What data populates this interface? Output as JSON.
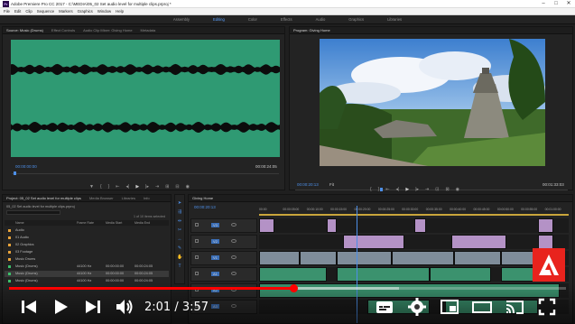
{
  "window": {
    "title": "Adobe Premiere Pro CC 2017 - C:\\MEDIA\\05_02 Set audio level for multiple clips.prproj *",
    "app_icon": "Pr"
  },
  "menu": [
    "File",
    "Edit",
    "Clip",
    "Sequence",
    "Markers",
    "Graphics",
    "Window",
    "Help"
  ],
  "workspaces": {
    "items": [
      "Assembly",
      "Editing",
      "Color",
      "Effects",
      "Audio",
      "Graphics",
      "Libraries"
    ],
    "active": "Editing"
  },
  "source_panel": {
    "tabs": [
      "Source: Music (Drums)",
      "Effect Controls",
      "Audio Clip Mixer: Giving Home",
      "Metadata"
    ],
    "timecode_left": "00:00:00:00",
    "timecode_right": "00:00:24:05",
    "waveform_color": "#2f9a73"
  },
  "program_panel": {
    "tab": "Program: Giving Home",
    "timecode_left": "00:00:20:13",
    "zoom": "Fit",
    "timecode_right": "00:01:33:03"
  },
  "project_panel": {
    "tabs": [
      "Project: 05_02 Set audio level for multiple clips",
      "Media Browser",
      "Libraries",
      "Info"
    ],
    "path": "05_02 Set audio level for multiple clips.prproj",
    "selected_count": "1 of 10 items selected",
    "columns": [
      "Name",
      "Frame Rate",
      "Media Start",
      "Media End"
    ],
    "rows": [
      {
        "name": "Audio",
        "color": "#e8a33a",
        "rate": "",
        "start": "",
        "end": ""
      },
      {
        "name": "01 Audio",
        "color": "#e8a33a",
        "rate": "",
        "start": "",
        "end": ""
      },
      {
        "name": "02 Graphics",
        "color": "#e8a33a",
        "rate": "",
        "start": "",
        "end": ""
      },
      {
        "name": "03 Footage",
        "color": "#e8a33a",
        "rate": "",
        "start": "",
        "end": ""
      },
      {
        "name": "Music Drums",
        "color": "#e8a33a",
        "rate": "",
        "start": "",
        "end": ""
      },
      {
        "name": "Music (Drums)",
        "color": "#3cbf6a",
        "rate": "44100 Hz",
        "start": "00:00:00:00",
        "end": "00:00:24:05"
      },
      {
        "name": "Music (Drums)",
        "color": "#3cbf6a",
        "rate": "44100 Hz",
        "start": "00:00:00:00",
        "end": "00:00:24:05"
      },
      {
        "name": "Music (Drums)",
        "color": "#3cbf6a",
        "rate": "44100 Hz",
        "start": "00:00:00:00",
        "end": "00:00:24:05"
      }
    ]
  },
  "timeline_panel": {
    "tab": "Giving Home",
    "timecode": "00:00:20:13",
    "ruler": [
      "00:00",
      "00:00:05:00",
      "00:00:10:00",
      "00:00:15:00",
      "00:00:20:00",
      "00:00:25:00",
      "00:00:30:00",
      "00:00:35:00",
      "00:00:40:00",
      "00:00:45:00",
      "00:00:50:00",
      "00:00:55:00",
      "00:01:00:00"
    ],
    "tracks": [
      "V3",
      "V2",
      "V1",
      "A1",
      "A2",
      "A3"
    ]
  },
  "player": {
    "time": "2:01 / 3:57",
    "progress": 0.511,
    "buffered": 0.7,
    "brand_color": "#e8231d"
  }
}
